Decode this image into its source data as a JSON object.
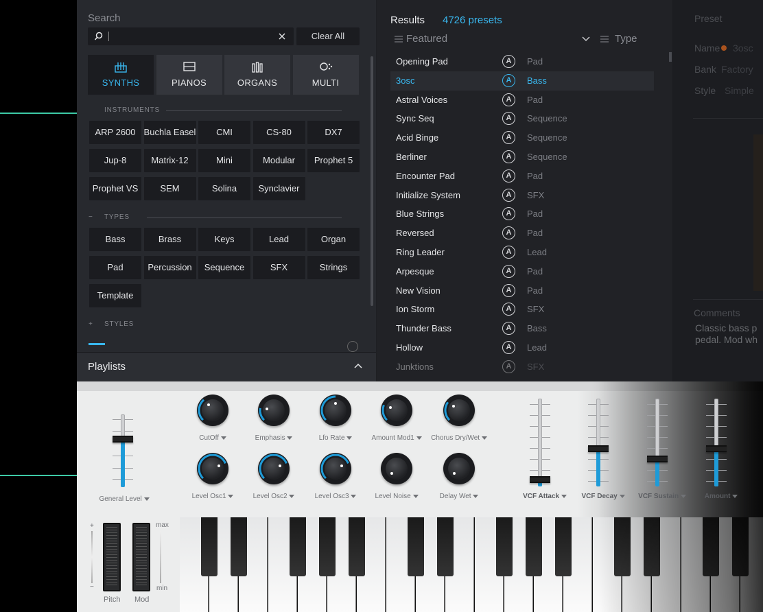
{
  "browser": {
    "search": {
      "label": "Search",
      "placeholder": "",
      "clear_label": "Clear All"
    },
    "categories": [
      {
        "label": "SYNTHS",
        "icon": "synth-icon",
        "active": true
      },
      {
        "label": "PIANOS",
        "icon": "piano-icon",
        "active": false
      },
      {
        "label": "ORGANS",
        "icon": "organ-icon",
        "active": false
      },
      {
        "label": "MULTI",
        "icon": "multi-icon",
        "active": false
      }
    ],
    "instruments_header": "INSTRUMENTS",
    "instruments": [
      "ARP 2600",
      "Buchla Easel",
      "CMI",
      "CS-80",
      "DX7",
      "Jup-8",
      "Matrix-12",
      "Mini",
      "Modular",
      "Prophet 5",
      "Prophet VS",
      "SEM",
      "Solina",
      "Synclavier"
    ],
    "types_header": "TYPES",
    "types_toggle": "−",
    "types": [
      "Bass",
      "Brass",
      "Keys",
      "Lead",
      "Organ",
      "Pad",
      "Percussion",
      "Sequence",
      "SFX",
      "Strings",
      "Template"
    ],
    "styles_header": "STYLES",
    "styles_toggle": "+",
    "playlists_label": "Playlists"
  },
  "results": {
    "title": "Results",
    "count": "4726 presets",
    "sort_column": "Featured",
    "type_column": "Type",
    "rows": [
      {
        "name": "Opening Pad",
        "type": "Pad"
      },
      {
        "name": "3osc",
        "type": "Bass",
        "selected": true
      },
      {
        "name": "Astral Voices",
        "type": "Pad"
      },
      {
        "name": "Sync Seq",
        "type": "Sequence"
      },
      {
        "name": "Acid Binge",
        "type": "Sequence"
      },
      {
        "name": "Berliner",
        "type": "Sequence"
      },
      {
        "name": "Encounter Pad",
        "type": "Pad"
      },
      {
        "name": "Initialize System",
        "type": "SFX"
      },
      {
        "name": "Blue Strings",
        "type": "Pad"
      },
      {
        "name": "Reversed",
        "type": "Pad"
      },
      {
        "name": "Ring Leader",
        "type": "Lead"
      },
      {
        "name": "Arpesque",
        "type": "Pad"
      },
      {
        "name": "New Vision",
        "type": "Pad"
      },
      {
        "name": "Ion Storm",
        "type": "SFX"
      },
      {
        "name": "Thunder Bass",
        "type": "Bass"
      },
      {
        "name": "Hollow",
        "type": "Lead"
      },
      {
        "name": "Junktions",
        "type": "SFX"
      }
    ],
    "row_icon_glyph": "A"
  },
  "preset_panel": {
    "title": "Preset",
    "name_label": "Name",
    "name_value": "3osc",
    "bank_label": "Bank",
    "bank_value": "Factory",
    "style_label": "Style",
    "style_value": "Simple",
    "comments_label": "Comments",
    "comments_text_1": "Classic bass p",
    "comments_text_2": "pedal. Mod wh"
  },
  "instrument": {
    "general_level": {
      "label": "General Level",
      "value": 0.7
    },
    "knobs_row1": [
      {
        "label": "CutOff",
        "value": 0.35
      },
      {
        "label": "Emphasis",
        "value": 0.2
      },
      {
        "label": "Lfo Rate",
        "value": 0.5
      },
      {
        "label": "Amount Mod1",
        "value": 0.25
      },
      {
        "label": "Chorus Dry/Wet",
        "value": 0.3
      }
    ],
    "knobs_row2": [
      {
        "label": "Level Osc1",
        "value": 0.75
      },
      {
        "label": "Level Osc2",
        "value": 0.75
      },
      {
        "label": "Level Osc3",
        "value": 0.75
      },
      {
        "label": "Level Noise",
        "value": 0.0
      },
      {
        "label": "Delay Wet",
        "value": 0.0
      }
    ],
    "faders": [
      {
        "label": "VCF Attack",
        "value": 0.05
      },
      {
        "label": "VCF Decay",
        "value": 0.4
      },
      {
        "label": "VCF Sustain",
        "value": 0.28
      },
      {
        "label": "Amount",
        "value": 0.4
      }
    ],
    "pitch_label": "Pitch",
    "mod_label": "Mod",
    "plus": "+",
    "minus": "−",
    "max_label": "max",
    "min_label": "min"
  },
  "colors": {
    "accent": "#39b7ee",
    "callout": "#3dc9a6"
  }
}
